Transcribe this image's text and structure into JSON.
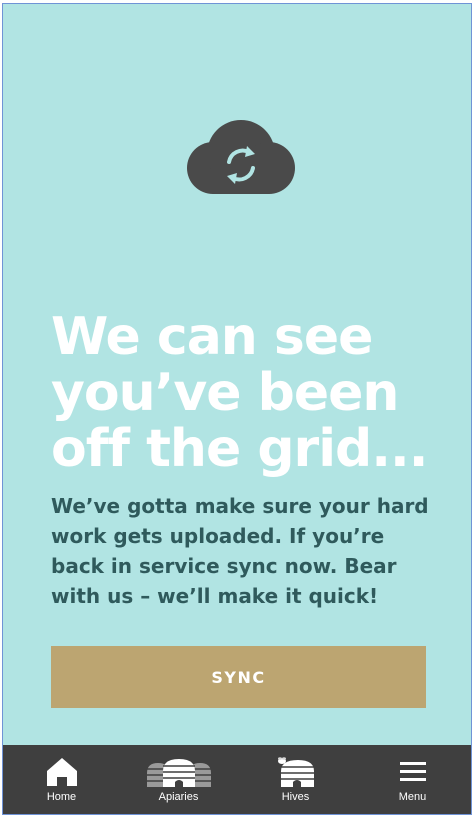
{
  "offline": {
    "icon": "cloud-sync-icon",
    "headline_line1": "We can see",
    "headline_line2": "you’ve been",
    "headline_line3": "off the grid...",
    "body_text": "We’ve gotta make sure your hard work gets uploaded. If you’re back in service sync now. Bear with us – we’ll make it quick!",
    "sync_label": "SYNC"
  },
  "tabbar": {
    "items": [
      {
        "label": "Home",
        "icon": "home-icon"
      },
      {
        "label": "Apiaries",
        "icon": "apiaries-icon"
      },
      {
        "label": "Hives",
        "icon": "hive-icon"
      },
      {
        "label": "Menu",
        "icon": "menu-icon"
      }
    ]
  },
  "colors": {
    "background": "#b1e4e3",
    "headline": "#ffffff",
    "body_text": "#2f5a5c",
    "button": "#bca571",
    "tabbar": "#3f3f3f",
    "icon": "#4a4a4a"
  }
}
